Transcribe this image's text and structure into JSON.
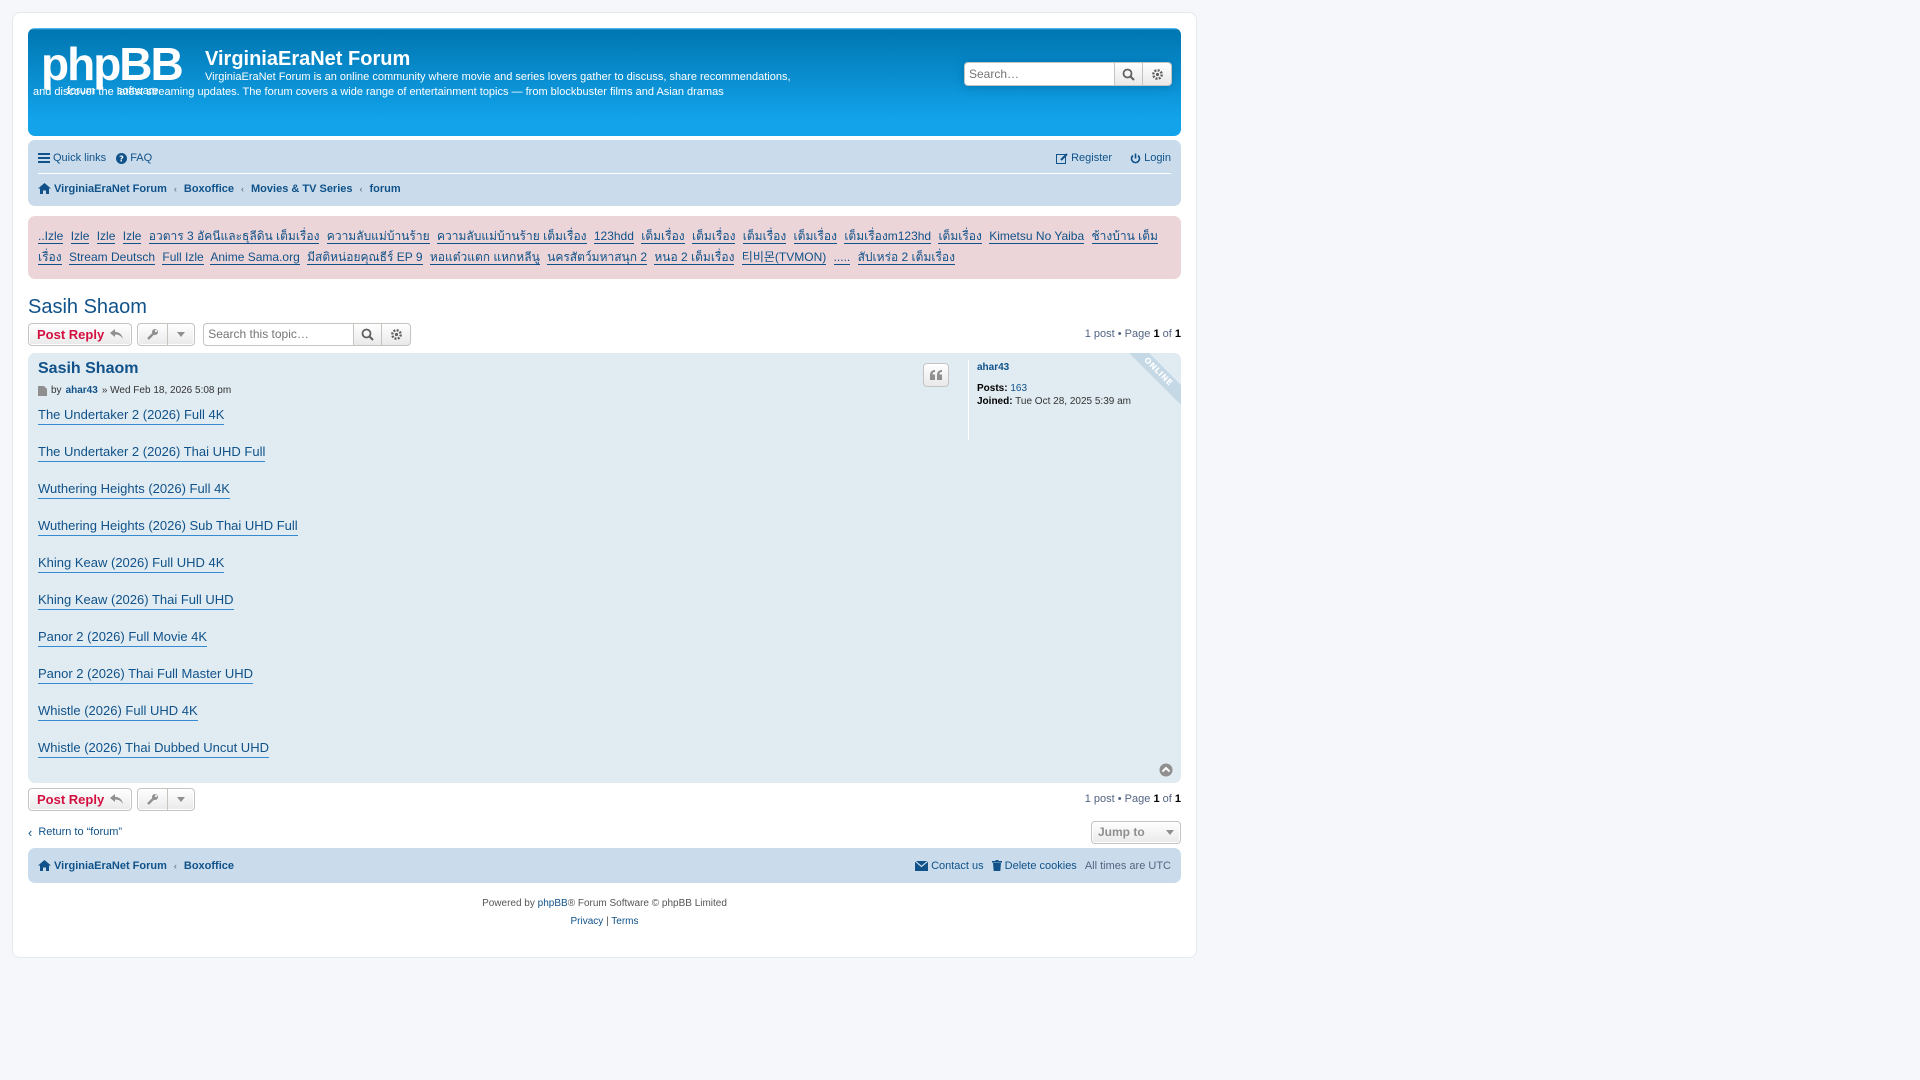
{
  "site": {
    "title": "VirginiaEraNet Forum",
    "description": "VirginiaEraNet Forum is an online community where movie and series lovers gather to discuss, share recommendations, and discover the latest streaming updates. The forum covers a wide range of entertainment topics — from blockbuster films and Asian dramas",
    "logo_text_main": "phpBB",
    "logo_text_sub": "forum software"
  },
  "header_search": {
    "placeholder": "Search…"
  },
  "navbar": {
    "quick_links": "Quick links",
    "faq": "FAQ",
    "register": "Register",
    "login": "Login",
    "breadcrumbs": [
      "VirginiaEraNet Forum",
      "Boxoffice",
      "Movies & TV Series",
      "forum"
    ]
  },
  "rules_links": [
    "..Izle",
    "Izle",
    "Izle",
    "Izle",
    "อวตาร 3 อัคนีและธุลีดิน เต็มเรื่อง",
    "ความลับแม่บ้านร้าย",
    "ความลับแม่บ้านร้าย เต็มเรื่อง",
    "123hdd",
    "เต็มเรื่อง",
    "เต็มเรื่อง",
    "เต็มเรื่อง",
    "เต็มเรื่อง",
    "เต็มเรื่องm123hd",
    "เต็มเรื่อง",
    "Kimetsu No Yaiba",
    "ช้างบ้าน เต็มเรื่อง",
    "Stream Deutsch",
    "Full Izle",
    "Anime Sama.org",
    "มีสติหน่อยคุณธีร์ EP 9",
    "หอแต๋วแตก แหกหลีนู",
    "นครสัตว์มหาสนุก 2",
    "หนอ 2 เต็มเรื่อง",
    "티비몬(TVMON)",
    ".....",
    "สัปเหร่อ 2 เต็มเรื่อง"
  ],
  "topic": {
    "title": "Sasih Shaom",
    "post_reply": "Post Reply",
    "search_placeholder": "Search this topic…",
    "pagination": {
      "prefix": "1 post • Page",
      "current": "1",
      "of": "of",
      "total": "1"
    },
    "return_link": "Return to “forum”",
    "jump_to": "Jump to"
  },
  "post": {
    "title": "Sasih Shaom",
    "by": "by",
    "author": "ahar43",
    "date": "» Wed Feb 18, 2026 5:08 pm",
    "links": [
      "The Undertaker 2 (2026) Full 4K",
      "The Undertaker 2 (2026) Thai UHD Full",
      "Wuthering Heights (2026) Full 4K",
      "Wuthering Heights (2026) Sub Thai UHD Full",
      "Khing Keaw (2026) Full UHD 4K",
      "Khing Keaw (2026) Thai Full UHD",
      "Panor 2 (2026) Full Movie 4K",
      "Panor 2 (2026) Thai Full Master UHD",
      "Whistle (2026) Full UHD 4K",
      "Whistle (2026) Thai Dubbed Uncut UHD"
    ],
    "profile": {
      "username": "ahar43",
      "posts_label": "Posts:",
      "posts_value": "163",
      "joined_label": "Joined:",
      "joined_value": "Tue Oct 28, 2025 5:39 am",
      "status": "ONLINE"
    }
  },
  "footer": {
    "breadcrumbs": [
      "VirginiaEraNet Forum",
      "Boxoffice"
    ],
    "contact": "Contact us",
    "delete_cookies": "Delete cookies",
    "timezone": "All times are UTC",
    "powered_prefix": "Powered by",
    "powered_link": "phpBB",
    "powered_suffix": "® Forum Software © phpBB Limited",
    "privacy": "Privacy",
    "separator": "|",
    "terms": "Terms"
  },
  "colors": {
    "header_blue": "#12a3eb",
    "link": "#105289",
    "reply_red": "#d31141",
    "nav_bg": "#cadceb",
    "post_bg": "#e1ebf2",
    "rules_bg": "#ecd5d8"
  }
}
